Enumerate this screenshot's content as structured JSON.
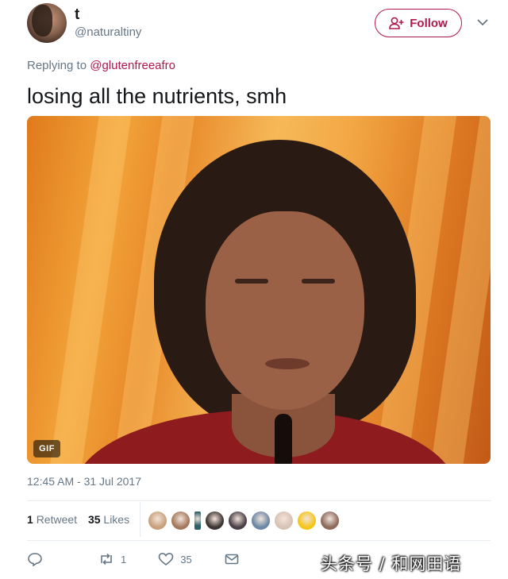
{
  "user": {
    "display_name": "t",
    "handle": "@naturaltiny",
    "avatar_icon": "profile-avatar"
  },
  "follow": {
    "label": "Follow",
    "icon": "person-add-icon",
    "accent": "#b0174d"
  },
  "menu": {
    "icon": "chevron-down-icon"
  },
  "reply": {
    "prefix": "Replying to",
    "mention": "@glutenfreeafro"
  },
  "tweet": {
    "text": "losing all the nutrients, smh",
    "media_badge": "GIF"
  },
  "timestamp": "12:45 AM - 31 Jul 2017",
  "stats": {
    "retweet_count": "1",
    "retweet_label": "Retweet",
    "like_count": "35",
    "like_label": "Likes"
  },
  "likers": [
    {
      "color": "#c9a07c"
    },
    {
      "color": "#a4785d"
    },
    {
      "color": "#2f5f6b"
    },
    {
      "color": "#3b3432"
    },
    {
      "color": "#4a3e47"
    },
    {
      "color": "#6c87a6"
    },
    {
      "color": "#d7c2b5"
    },
    {
      "color": "#f5c518"
    },
    {
      "color": "#8d6a5c"
    }
  ],
  "actions": {
    "reply_count": "",
    "retweet_count": "1",
    "like_count": "35"
  },
  "watermark": "头条号 / 和网田语"
}
